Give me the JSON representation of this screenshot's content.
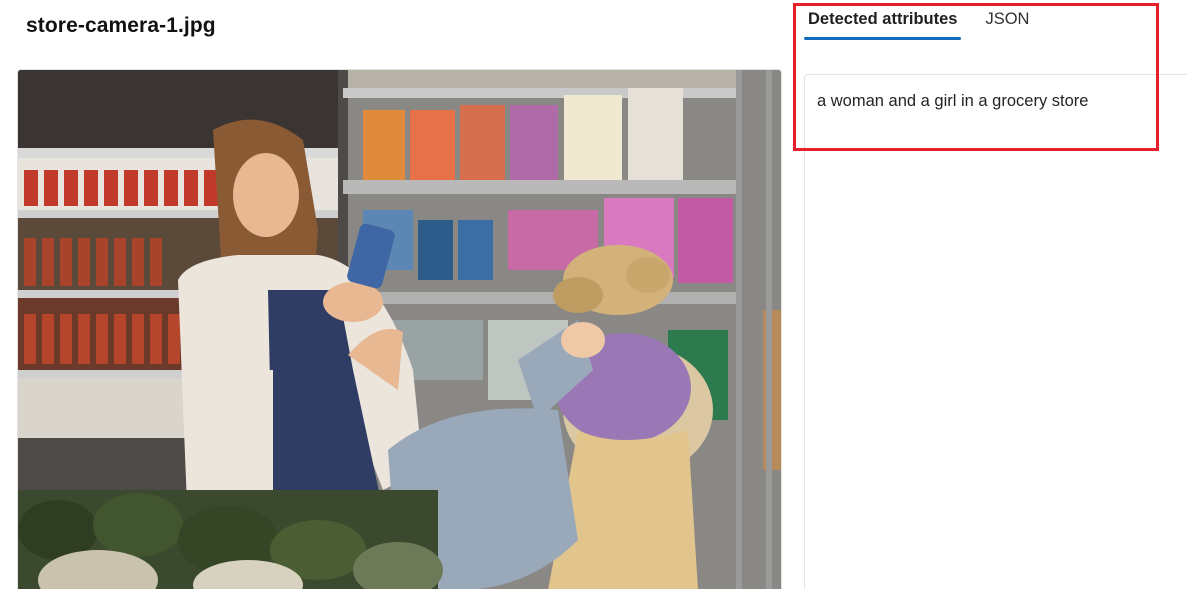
{
  "file": {
    "name": "store-camera-1.jpg"
  },
  "tabs": [
    {
      "label": "Detected attributes",
      "active": true
    },
    {
      "label": "JSON",
      "active": false
    }
  ],
  "result": {
    "caption": "a woman and a girl in a grocery store"
  },
  "colors": {
    "accent": "#0f6cbd",
    "highlight": "#e5202a"
  }
}
